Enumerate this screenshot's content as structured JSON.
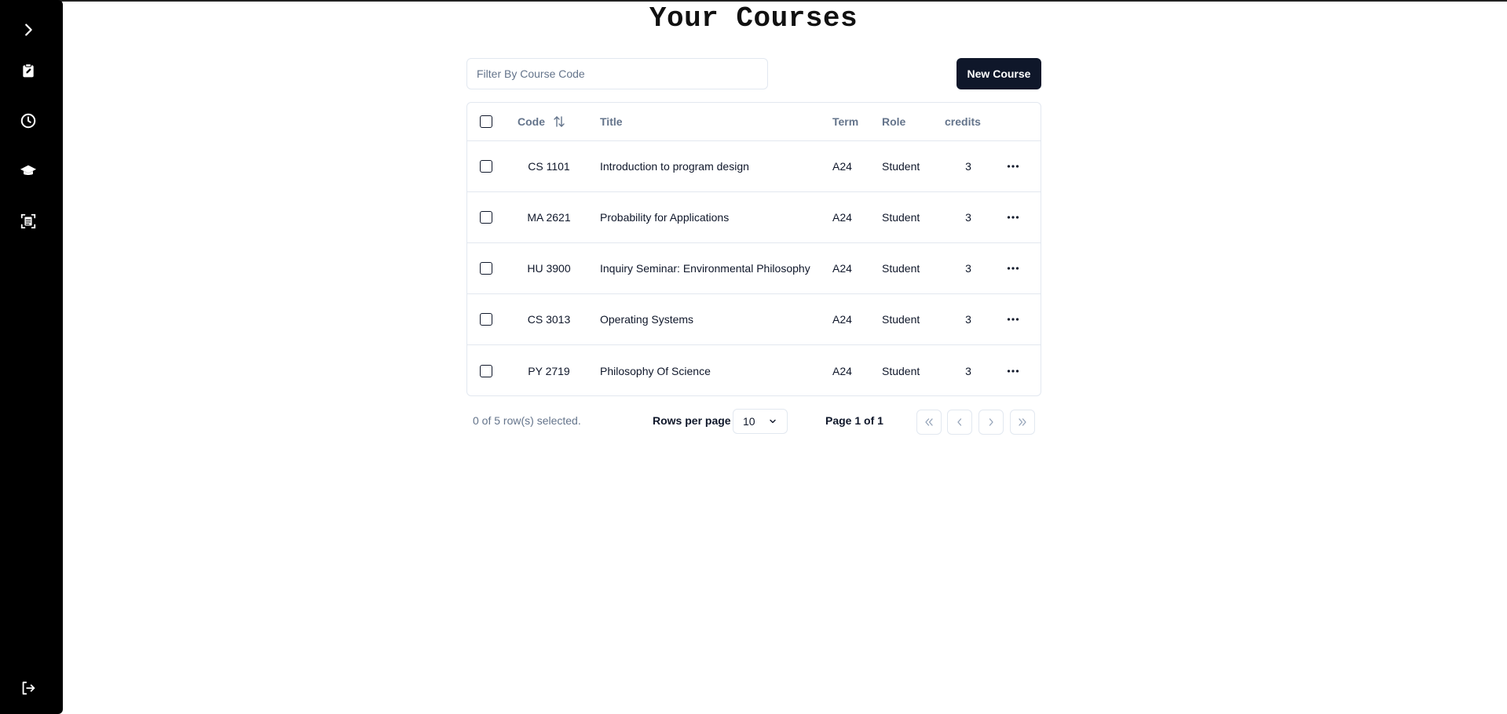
{
  "page": {
    "title": "Your Courses"
  },
  "sidebar": {
    "items": [
      {
        "icon": "chevron-right-icon"
      },
      {
        "icon": "clipboard-edit-icon"
      },
      {
        "icon": "clock-icon"
      },
      {
        "icon": "graduation-cap-icon"
      },
      {
        "icon": "document-scan-icon"
      },
      {
        "icon": "logout-icon"
      }
    ]
  },
  "filter": {
    "placeholder": "Filter By Course Code",
    "value": ""
  },
  "new_course_label": "New Course",
  "table": {
    "columns": {
      "code": "Code",
      "title": "Title",
      "term": "Term",
      "role": "Role",
      "credits": "credits"
    },
    "rows": [
      {
        "code": "CS 1101",
        "title": "Introduction to program design",
        "term": "A24",
        "role": "Student",
        "credits": "3"
      },
      {
        "code": "MA 2621",
        "title": "Probability for Applications",
        "term": "A24",
        "role": "Student",
        "credits": "3"
      },
      {
        "code": "HU 3900",
        "title": "Inquiry Seminar: Environmental Philosophy",
        "term": "A24",
        "role": "Student",
        "credits": "3"
      },
      {
        "code": "CS 3013",
        "title": "Operating Systems",
        "term": "A24",
        "role": "Student",
        "credits": "3"
      },
      {
        "code": "PY 2719",
        "title": "Philosophy Of Science",
        "term": "A24",
        "role": "Student",
        "credits": "3"
      }
    ]
  },
  "footer": {
    "selected_text": "0 of 5 row(s) selected.",
    "rows_per_page_label": "Rows per page",
    "rows_per_page_value": "10",
    "page_text": "Page 1 of 1"
  },
  "colors": {
    "sidebar": "#000000",
    "primary_button": "#0f172a",
    "border": "#e2e8f0",
    "muted_text": "#64748b"
  }
}
